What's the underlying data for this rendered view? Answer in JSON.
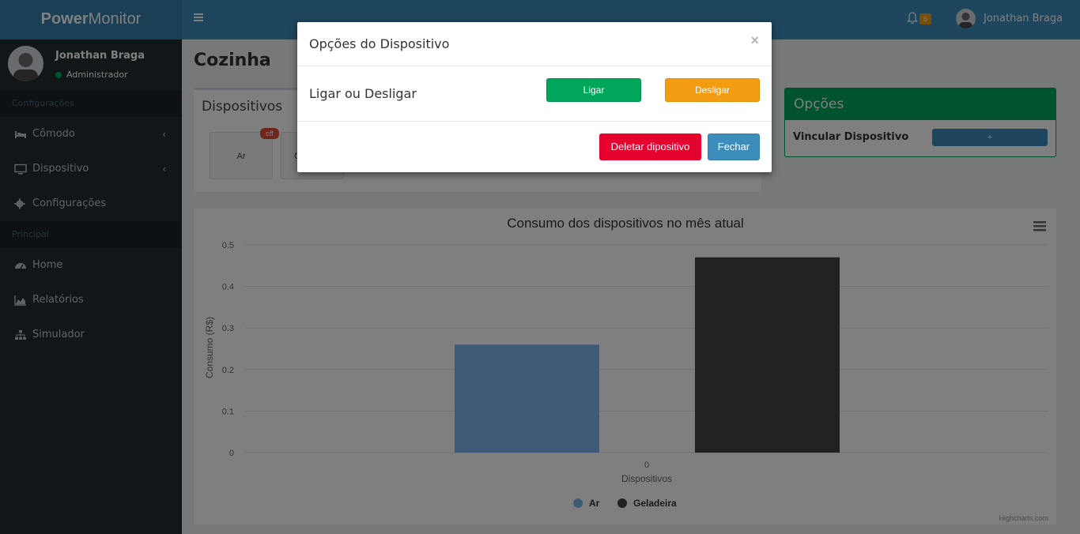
{
  "header": {
    "logo_bold": "Power",
    "logo_rest": "Monitor",
    "notification_count": "6",
    "username": "Jonathan Braga"
  },
  "sidebar": {
    "user_name": "Jonathan Braga",
    "user_role": "Administrador",
    "section_config": "Configurações",
    "section_main": "Principal",
    "items": [
      {
        "label": "Cômodo",
        "icon": "bed-icon"
      },
      {
        "label": "Dispositivo",
        "icon": "monitor-icon"
      },
      {
        "label": "Configurações",
        "icon": "gear-icon"
      },
      {
        "label": "Home",
        "icon": "dashboard-icon"
      },
      {
        "label": "Relatórios",
        "icon": "area-chart-icon"
      },
      {
        "label": "Simulador",
        "icon": "sitemap-icon"
      }
    ]
  },
  "page": {
    "title": "Cozinha",
    "devices_box_title": "Dispositivos",
    "device_1": "Ar",
    "device_2": "G",
    "device_1_status": "off",
    "options_title": "Opções",
    "link_device_label": "Vincular Dispositivo",
    "link_device_button": "+"
  },
  "chart_data": {
    "type": "bar",
    "title": "Consumo dos dispositivos no mês atual",
    "xlabel": "Dispositivos",
    "ylabel": "Consumo (R$)",
    "categories": [
      "0"
    ],
    "yticks": [
      "0",
      "0.1",
      "0.2",
      "0.3",
      "0.4",
      "0.5"
    ],
    "ylim": [
      0,
      0.5
    ],
    "series": [
      {
        "name": "Ar",
        "values": [
          0.26
        ],
        "color": "#7cb5ec"
      },
      {
        "name": "Geladeira",
        "values": [
          0.47
        ],
        "color": "#434348"
      }
    ],
    "legend": "bottom-center",
    "credits": "Highcharts.com"
  },
  "modal": {
    "title": "Opções do Dispositivo",
    "close": "×",
    "toggle_label": "Ligar ou Desligar",
    "on_button": "Ligar",
    "off_button": "Desligar",
    "delete_button": "Deletar dipositivo",
    "close_button": "Fechar"
  }
}
